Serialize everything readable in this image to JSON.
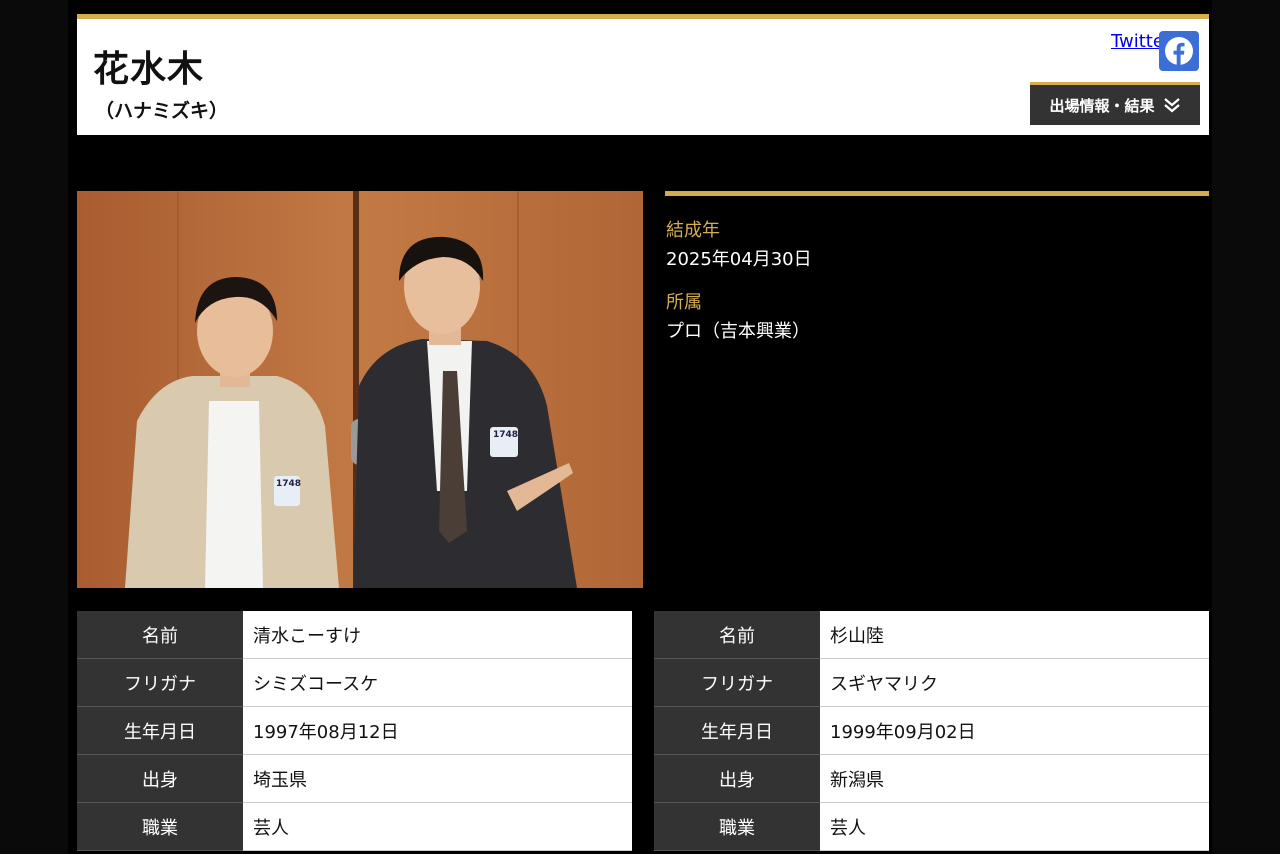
{
  "header": {
    "title": "花水木",
    "title_kana": "（ハナミズキ）",
    "twitter_label": "Twitter",
    "entry_button_label": "出場情報・結果"
  },
  "colors": {
    "accent_gold": "#d4ad4f",
    "facebook_blue": "#3b6fd6",
    "label_bg": "#333333"
  },
  "icons": {
    "facebook": "facebook-icon",
    "chevron": "double-chevron-down-icon"
  },
  "photo": {
    "badge_number": "1748"
  },
  "info": {
    "formed_label": "結成年",
    "formed_value": "2025年04月30日",
    "affiliation_label": "所属",
    "affiliation_value": "プロ（吉本興業）"
  },
  "members": [
    {
      "rows": [
        {
          "label": "名前",
          "value": "清水こーすけ"
        },
        {
          "label": "フリガナ",
          "value": "シミズコースケ"
        },
        {
          "label": "生年月日",
          "value": "1997年08月12日"
        },
        {
          "label": "出身",
          "value": "埼玉県"
        },
        {
          "label": "職業",
          "value": "芸人"
        }
      ]
    },
    {
      "rows": [
        {
          "label": "名前",
          "value": "杉山陸"
        },
        {
          "label": "フリガナ",
          "value": "スギヤマリク"
        },
        {
          "label": "生年月日",
          "value": "1999年09月02日"
        },
        {
          "label": "出身",
          "value": "新潟県"
        },
        {
          "label": "職業",
          "value": "芸人"
        }
      ]
    }
  ]
}
